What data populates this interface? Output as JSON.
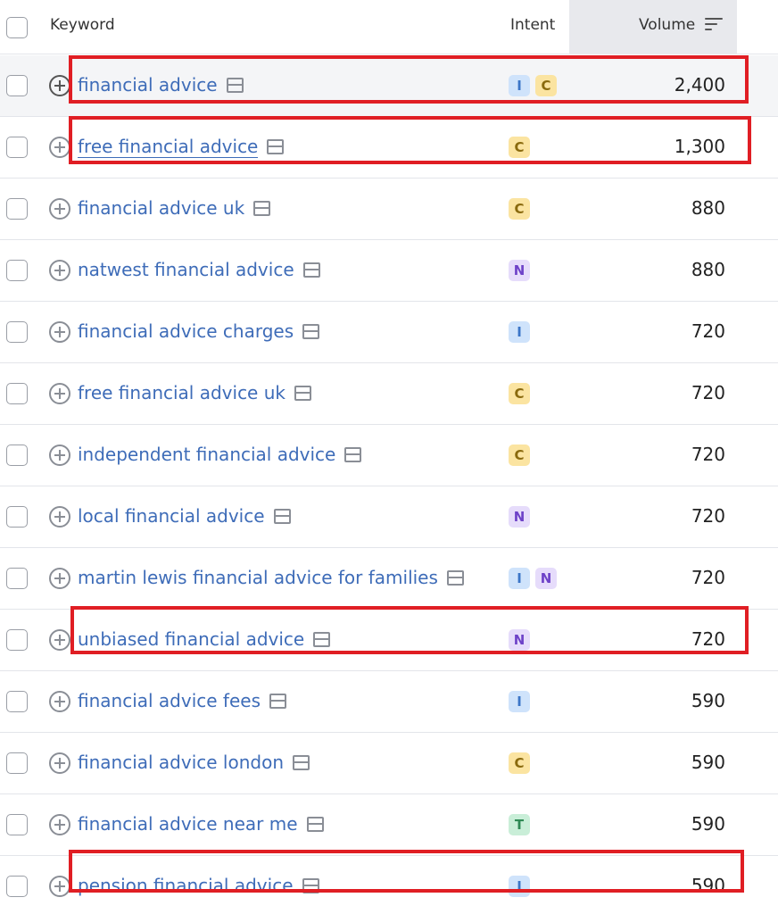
{
  "header": {
    "keyword_label": "Keyword",
    "intent_label": "Intent",
    "volume_label": "Volume",
    "sort_icon": "sort-descending-icon"
  },
  "rows": [
    {
      "keyword": "financial advice",
      "intents": [
        "I",
        "C"
      ],
      "volume": "2,400",
      "highlighted": true
    },
    {
      "keyword": "free financial advice",
      "intents": [
        "C"
      ],
      "volume": "1,300",
      "highlighted": true
    },
    {
      "keyword": "financial advice uk",
      "intents": [
        "C"
      ],
      "volume": "880",
      "highlighted": false
    },
    {
      "keyword": "natwest financial advice",
      "intents": [
        "N"
      ],
      "volume": "880",
      "highlighted": false
    },
    {
      "keyword": "financial advice charges",
      "intents": [
        "I"
      ],
      "volume": "720",
      "highlighted": false
    },
    {
      "keyword": "free financial advice uk",
      "intents": [
        "C"
      ],
      "volume": "720",
      "highlighted": false
    },
    {
      "keyword": "independent financial advice",
      "intents": [
        "C"
      ],
      "volume": "720",
      "highlighted": false
    },
    {
      "keyword": "local financial advice",
      "intents": [
        "N"
      ],
      "volume": "720",
      "highlighted": false
    },
    {
      "keyword": "martin lewis financial advice for families",
      "intents": [
        "I",
        "N"
      ],
      "volume": "720",
      "highlighted": false
    },
    {
      "keyword": "unbiased financial advice",
      "intents": [
        "N"
      ],
      "volume": "720",
      "highlighted": true
    },
    {
      "keyword": "financial advice fees",
      "intents": [
        "I"
      ],
      "volume": "590",
      "highlighted": false
    },
    {
      "keyword": "financial advice london",
      "intents": [
        "C"
      ],
      "volume": "590",
      "highlighted": false
    },
    {
      "keyword": "financial advice near me",
      "intents": [
        "T"
      ],
      "volume": "590",
      "highlighted": false
    },
    {
      "keyword": "pension financial advice",
      "intents": [
        "I"
      ],
      "volume": "590",
      "highlighted": true
    }
  ],
  "colors": {
    "keyword_link": "#3e6cb8",
    "highlight_box": "#e01e24",
    "intent_I": "#cfe3fb",
    "intent_C": "#fbe4a1",
    "intent_N": "#e6dcfb",
    "intent_T": "#c9eed8"
  }
}
